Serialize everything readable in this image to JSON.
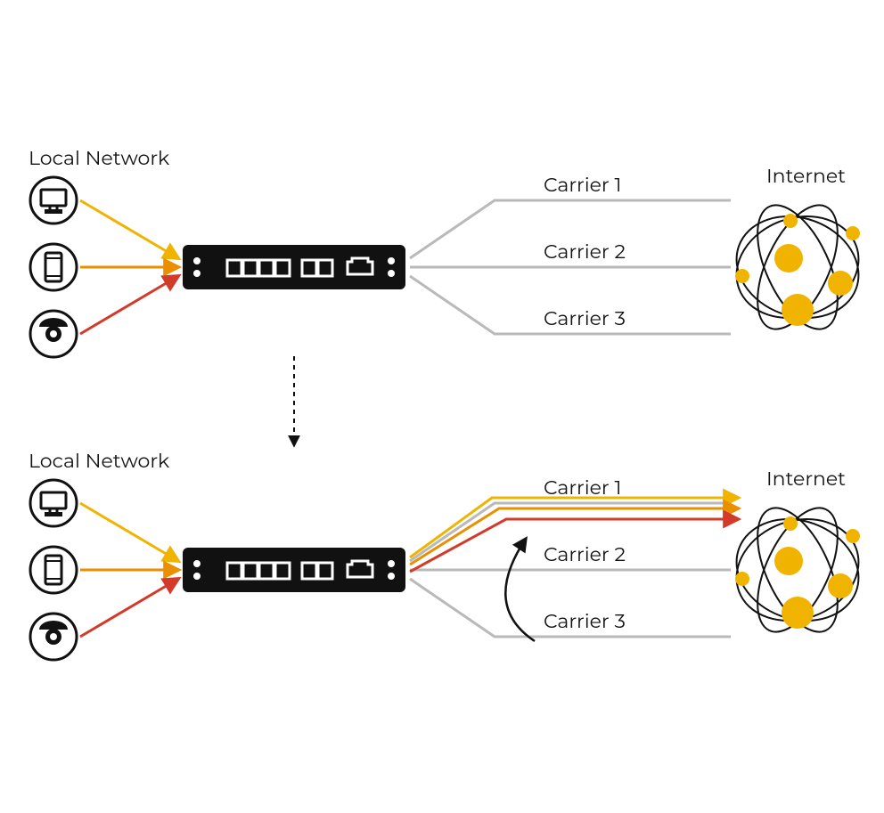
{
  "colors": {
    "yellow": "#f0b400",
    "orange": "#ea8f00",
    "red": "#d33a2a",
    "gray": "#b9b9b9",
    "black": "#111"
  },
  "labels": {
    "local_network": "Local Network",
    "internet": "Internet",
    "carrier1": "Carrier 1",
    "carrier2": "Carrier 2",
    "carrier3": "Carrier 3"
  },
  "diagram": {
    "type": "network",
    "description": "Two-state network diagram showing a router/gateway between a local network (computer, phone, camera) and the Internet via three carrier links. Top state: traffic spread across carriers. Bottom state: all traffic converged onto Carrier 1; Carriers 2 and 3 idle.",
    "local_devices": [
      "computer",
      "phone",
      "camera"
    ],
    "carriers": [
      "Carrier 1",
      "Carrier 2",
      "Carrier 3"
    ],
    "states": [
      {
        "name": "before",
        "active_carriers": [
          1,
          2,
          3
        ]
      },
      {
        "name": "after",
        "active_carriers": [
          1
        ],
        "converge_arrow": true
      }
    ]
  }
}
